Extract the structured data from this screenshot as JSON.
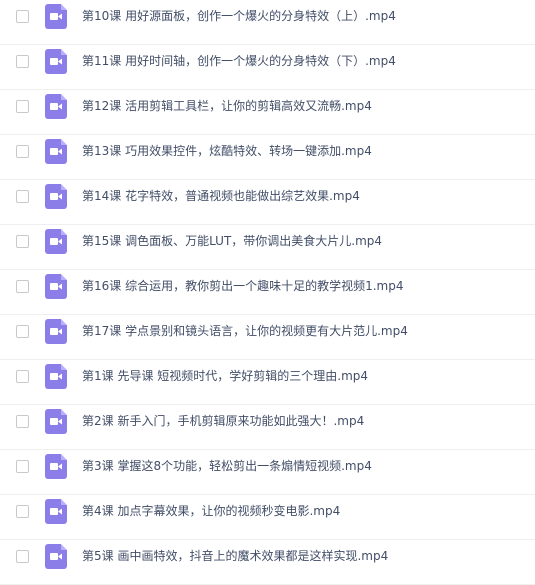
{
  "files": [
    {
      "name": "第10课 用好源面板，创作一个爆火的分身特效（上）.mp4",
      "icon": "video-file-icon"
    },
    {
      "name": "第11课 用好时间轴，创作一个爆火的分身特效（下）.mp4",
      "icon": "video-file-icon"
    },
    {
      "name": "第12课 活用剪辑工具栏，让你的剪辑高效又流畅.mp4",
      "icon": "video-file-icon"
    },
    {
      "name": "第13课 巧用效果控件，炫酷特效、转场一键添加.mp4",
      "icon": "video-file-icon"
    },
    {
      "name": "第14课 花字特效，普通视频也能做出综艺效果.mp4",
      "icon": "video-file-icon"
    },
    {
      "name": "第15课 调色面板、万能LUT，带你调出美食大片儿.mp4",
      "icon": "video-file-icon"
    },
    {
      "name": "第16课 综合运用，教你剪出一个趣味十足的教学视频1.mp4",
      "icon": "video-file-icon"
    },
    {
      "name": "第17课 学点景别和镜头语言，让你的视频更有大片范儿.mp4",
      "icon": "video-file-icon"
    },
    {
      "name": "第1课 先导课 短视频时代，学好剪辑的三个理由.mp4",
      "icon": "video-file-icon"
    },
    {
      "name": "第2课 新手入门，手机剪辑原来功能如此强大！.mp4",
      "icon": "video-file-icon"
    },
    {
      "name": "第3课 掌握这8个功能，轻松剪出一条煽情短视频.mp4",
      "icon": "video-file-icon"
    },
    {
      "name": "第4课 加点字幕效果，让你的视频秒变电影.mp4",
      "icon": "video-file-icon"
    },
    {
      "name": "第5课 画中画特效，抖音上的魔术效果都是这样实现.mp4",
      "icon": "video-file-icon"
    }
  ],
  "colors": {
    "icon": "#8b7ee8",
    "text": "#424e67",
    "divider": "#efefef"
  }
}
